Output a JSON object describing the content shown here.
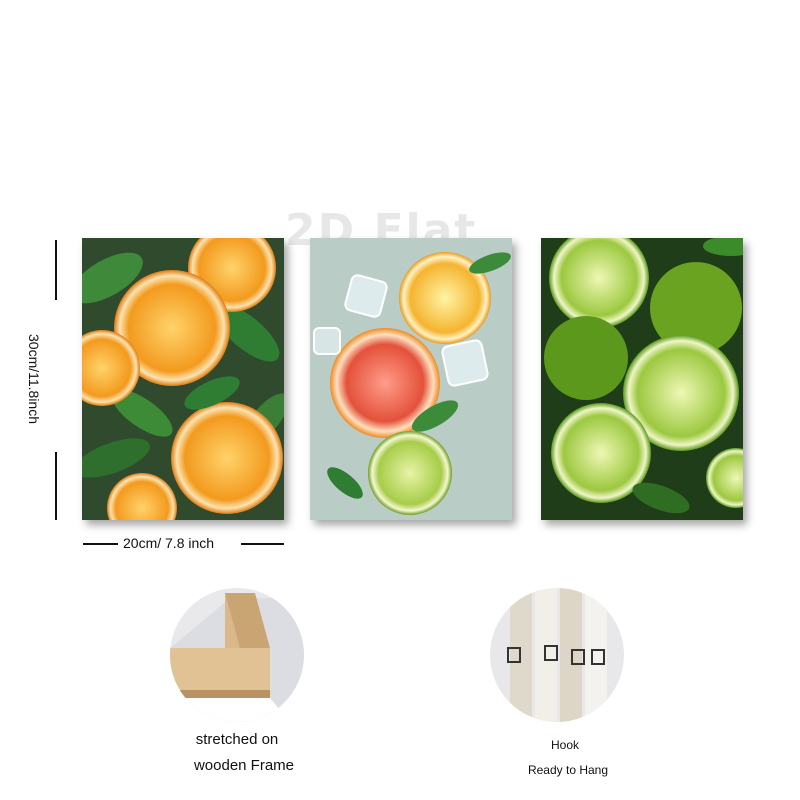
{
  "dimensions": {
    "height_label": "30cm/11.8inch",
    "width_label": "20cm/ 7.8 inch"
  },
  "watermark": "2D Flat",
  "panels": [
    {
      "subject": "orange slices with leaves"
    },
    {
      "subject": "citrus slices with ice cubes in water"
    },
    {
      "subject": "lime slices with water droplets"
    }
  ],
  "features": [
    {
      "caption_line1": "stretched on",
      "caption_line2": "wooden Frame"
    },
    {
      "caption_line1": "Hook",
      "caption_line2": "Ready to Hang"
    }
  ],
  "colors": {
    "orange": "#f39a1e",
    "lime": "#8cc63f",
    "leaf": "#2e7d32",
    "water": "#b9ccc6"
  }
}
